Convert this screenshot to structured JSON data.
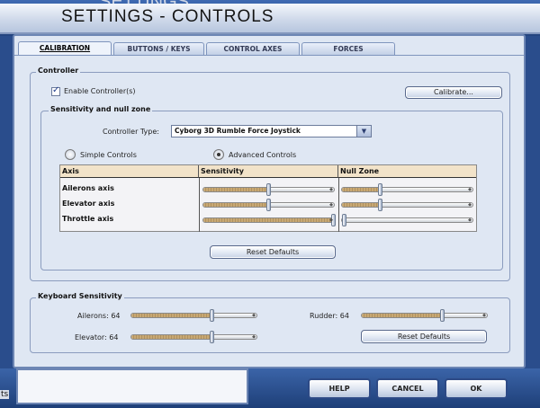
{
  "window": {
    "ghost_title": "SETTINGS",
    "title": "SETTINGS - CONTROLS"
  },
  "tabs": [
    {
      "label": "CALIBRATION",
      "active": true
    },
    {
      "label": "BUTTONS / KEYS",
      "active": false
    },
    {
      "label": "CONTROL AXES",
      "active": false
    },
    {
      "label": "FORCES",
      "active": false
    }
  ],
  "controller": {
    "group_label": "Controller",
    "enable_label": "Enable Controller(s)",
    "enable_checked": true,
    "calibrate_label": "Calibrate...",
    "sensitivity_group_label": "Sensitivity and null zone",
    "type_label": "Controller Type:",
    "type_value": "Cyborg 3D Rumble Force Joystick",
    "simple_label": "Simple Controls",
    "advanced_label": "Advanced Controls",
    "mode": "advanced",
    "table_headers": [
      "Axis",
      "Sensitivity",
      "Null Zone"
    ],
    "axes": [
      {
        "name": "Ailerons axis",
        "sensitivity": 0.49,
        "null_zone": 0.28
      },
      {
        "name": "Elevator axis",
        "sensitivity": 0.49,
        "null_zone": 0.28
      },
      {
        "name": "Throttle axis",
        "sensitivity": 1.0,
        "null_zone": 0.0
      }
    ],
    "reset_label": "Reset Defaults"
  },
  "keyboard": {
    "group_label": "Keyboard Sensitivity",
    "ailerons_label": "Ailerons: 64",
    "ailerons_value": 0.64,
    "elevator_label": "Elevator: 64",
    "elevator_value": 0.64,
    "rudder_label": "Rudder: 64",
    "rudder_value": 0.64,
    "reset_label": "Reset Defaults"
  },
  "footer": {
    "side_label": "ts",
    "help_label": "HELP",
    "cancel_label": "CANCEL",
    "ok_label": "OK"
  },
  "colors": {
    "slider_fill": "#c8a874",
    "table_header": "#f2e3c9",
    "panel": "#dfe7f3",
    "frame": "#2a4d8c"
  }
}
